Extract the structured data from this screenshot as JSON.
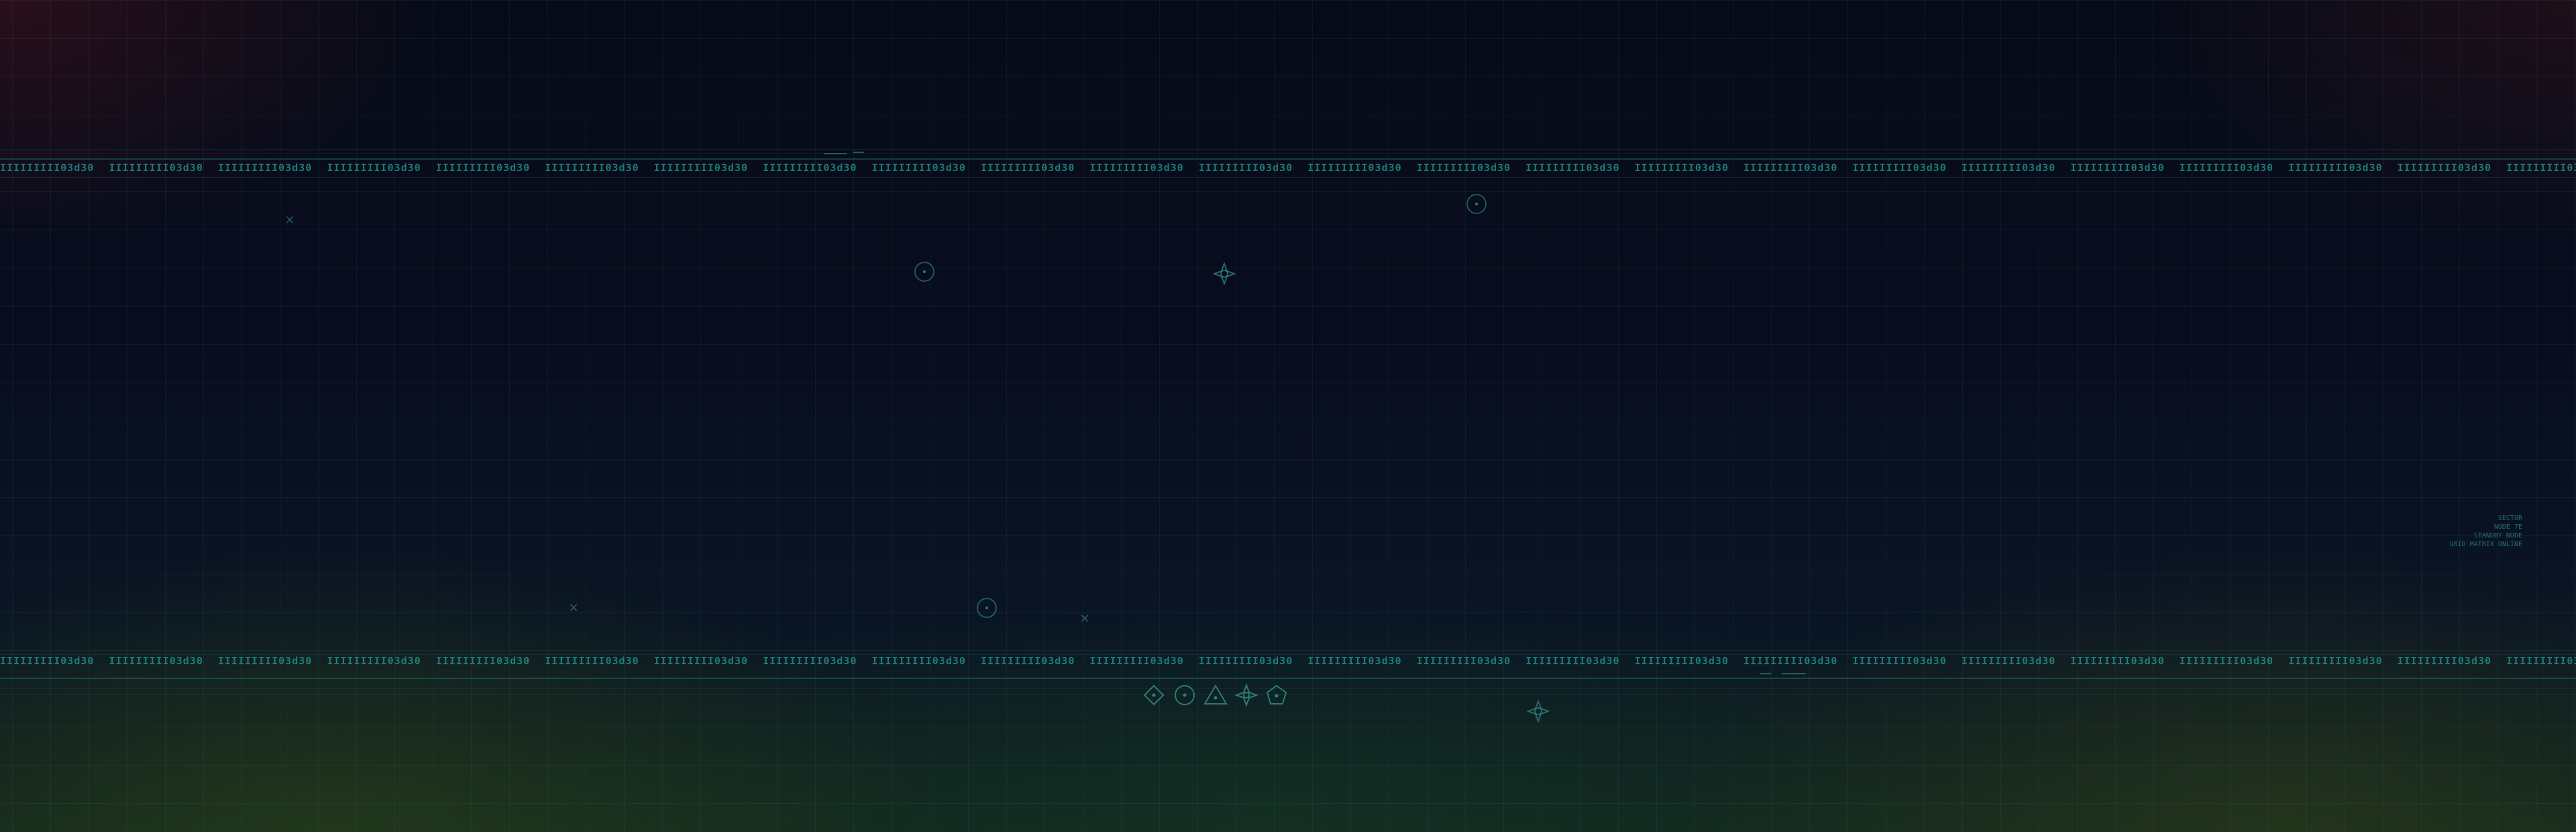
{
  "tick_strip": {
    "unit_text": "IIIIIIIII03d30",
    "count": 24
  },
  "legend": {
    "lines": [
      "SECTOR",
      "NODE 7E",
      "STANDBY NODE",
      "GRID MATRIX ONLINE"
    ]
  },
  "colors": {
    "accent": "#1e8f86",
    "line": "#2a9696",
    "background": "#070b16"
  },
  "icons": {
    "reticles": [
      "reticle-icon",
      "reticle-icon",
      "reticle-icon"
    ],
    "crosses": [
      "cross-icon",
      "cross-icon",
      "cross-icon"
    ],
    "stars": [
      "star-icon",
      "star-icon"
    ],
    "shape_row": [
      "diamond-icon",
      "circle-icon",
      "triangle-icon",
      "star-icon",
      "pentagon-icon"
    ]
  }
}
